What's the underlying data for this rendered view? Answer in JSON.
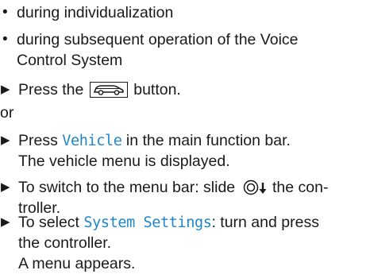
{
  "bullets": [
    {
      "line1": "during individualization"
    },
    {
      "line1": "during subsequent operation of the Voice",
      "line2": "Control System"
    }
  ],
  "steps": {
    "press_car": {
      "before": "Press the",
      "after": "button."
    },
    "or": "or",
    "press_vehicle": {
      "before": "Press",
      "term": "Vehicle",
      "after": "in the main function bar.",
      "line2": "The vehicle menu is displayed."
    },
    "switch_menu": {
      "before": "To switch to the menu bar: slide",
      "after": "the con-",
      "line2": "troller."
    },
    "select_settings": {
      "before": "To select",
      "term": "System Settings",
      "after": ": turn and press",
      "line2": "the controller.",
      "line3": "A menu appears."
    }
  },
  "icons": {
    "bullet": "•",
    "step_arrow": "▶",
    "car_button": "car-icon",
    "controller": "controller-slide-down-icon"
  },
  "colors": {
    "term": "#1f86c8",
    "text": "#1a1a1a"
  }
}
